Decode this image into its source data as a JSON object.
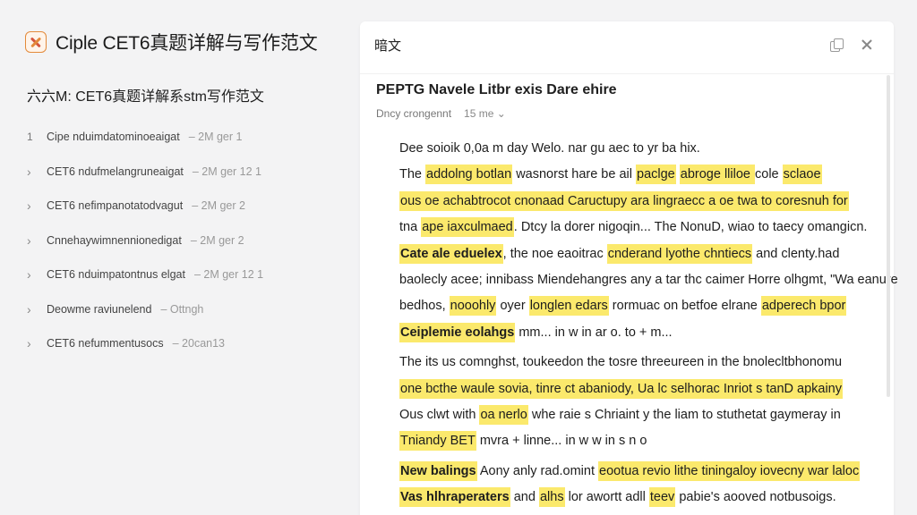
{
  "sidebar": {
    "brand_title": "Ciple CET6真题详解与写作范文",
    "section_title": "六六M: CET6真题详解系stm写作范文",
    "history": [
      {
        "mark": "1",
        "text": "Cipe nduimdatominoeaigat",
        "meta": "– 2M ger 1"
      },
      {
        "mark": "›",
        "text": "CET6 ndufmelangruneaigat",
        "meta": "– 2M ger 12 1"
      },
      {
        "mark": "›",
        "text": "CET6 nefimpanotatodvagut",
        "meta": "– 2M ger 2"
      },
      {
        "mark": "›",
        "text": "Cnnehaywimnennionedigat",
        "meta": "– 2M ger 2"
      },
      {
        "mark": "›",
        "text": "CET6 nduimpatontnus elgat",
        "meta": "– 2M ger 12 1"
      },
      {
        "mark": "›",
        "text": "Deowme raviunelend",
        "meta": "– Ottngh"
      },
      {
        "mark": "›",
        "text": "CET6 nefummentusocs",
        "meta": "– 20can13"
      }
    ]
  },
  "panel": {
    "header": "暗文",
    "doc_title": "PEPTG Navele Litbr exis Dare ehire",
    "doc_meta_label": "Dncy crongennt",
    "doc_meta_time": "15 me ⌄",
    "lines": [
      {
        "segments": [
          {
            "t": "Dee soioik 0,0a m    day    Welo.    nar    gu    aec    to    yr    ba    hix.",
            "h": false
          }
        ]
      },
      {
        "segments": [
          {
            "t": "The ",
            "h": false
          },
          {
            "t": "addolng botlan",
            "h": true
          },
          {
            "t": " wasnorst hare be ail ",
            "h": false
          },
          {
            "t": "paclge",
            "h": true
          },
          {
            "t": " ",
            "h": false
          },
          {
            "t": "abroge lliloe ",
            "h": true
          },
          {
            "t": "cole ",
            "h": false
          },
          {
            "t": "sclaoe",
            "h": true
          }
        ]
      },
      {
        "segments": [
          {
            "t": "ous oe achabtrocot cnonaad Caructupy ara lingraecc a oe twa to coresnuh for",
            "h": true
          }
        ]
      },
      {
        "segments": [
          {
            "t": "tna ",
            "h": false
          },
          {
            "t": "ape iaxculmaed",
            "h": true
          },
          {
            "t": ". Dtcy la dorer nigoqin... The NonuD, wiao to taecy omangicn.",
            "h": false
          }
        ]
      },
      {
        "segments": [
          {
            "t": "Cate ale eduelex",
            "h": true,
            "b": true
          },
          {
            "t": ", the noe eaoitrac ",
            "h": false
          },
          {
            "t": "cnderand lyothe chntiecs",
            "h": true
          },
          {
            "t": " and clenty.had",
            "h": false
          }
        ]
      },
      {
        "segments": [
          {
            "t": "baolecly acee; innibass Miendehangres any a tar thc caimer Horre olhgmt, \"Wa eanure",
            "h": false
          }
        ]
      },
      {
        "segments": [
          {
            "t": "bedhos, ",
            "h": false
          },
          {
            "t": "nooohly",
            "h": true
          },
          {
            "t": " oyer ",
            "h": false
          },
          {
            "t": "longlen edars",
            "h": true
          },
          {
            "t": " rormuac on betfoe elrane ",
            "h": false
          },
          {
            "t": "adperech bpor",
            "h": true
          }
        ]
      },
      {
        "segments": [
          {
            "t": "Ceiplemie eolahgs",
            "h": true,
            "b": true
          },
          {
            "t": "   mm...             in      w         in      ar      o.      to + m...",
            "h": false
          }
        ]
      },
      {
        "gap": true,
        "segments": [
          {
            "t": "The its us comnghst, toukeedon the tosre threeureen in the bnolecltbhonomu",
            "h": false
          }
        ]
      },
      {
        "segments": [
          {
            "t": "one bcthe waule sovia, tinre ct abaniody, Ua lc selhorac Inriot s tanD apkainy",
            "h": true
          }
        ]
      },
      {
        "segments": [
          {
            "t": "Ous clwt with ",
            "h": false
          },
          {
            "t": "oa nerlo",
            "h": true
          },
          {
            "t": " whe raie s Chriaint y the liam to stuthetat gaymeray in",
            "h": false
          }
        ]
      },
      {
        "segments": [
          {
            "t": "Tniandy BET",
            "h": true
          },
          {
            "t": " mvra + linne...          in      w        w        in      s       n       o",
            "h": false
          }
        ]
      },
      {
        "gap": true,
        "segments": [
          {
            "t": "New balings",
            "h": true,
            "b": true
          },
          {
            "t": " Aony anly rad.omint ",
            "h": false
          },
          {
            "t": "eootua revio lithe tiningaloy iovecny war laloc",
            "h": true
          }
        ]
      },
      {
        "segments": [
          {
            "t": "Vas hlhraperaters",
            "h": true,
            "b": true
          },
          {
            "t": " and ",
            "h": false
          },
          {
            "t": "alhs",
            "h": true
          },
          {
            "t": " lor awortt adll ",
            "h": false
          },
          {
            "t": "teev",
            "h": true
          },
          {
            "t": " pabie's aooved notbusoigs.",
            "h": false
          }
        ]
      }
    ]
  }
}
